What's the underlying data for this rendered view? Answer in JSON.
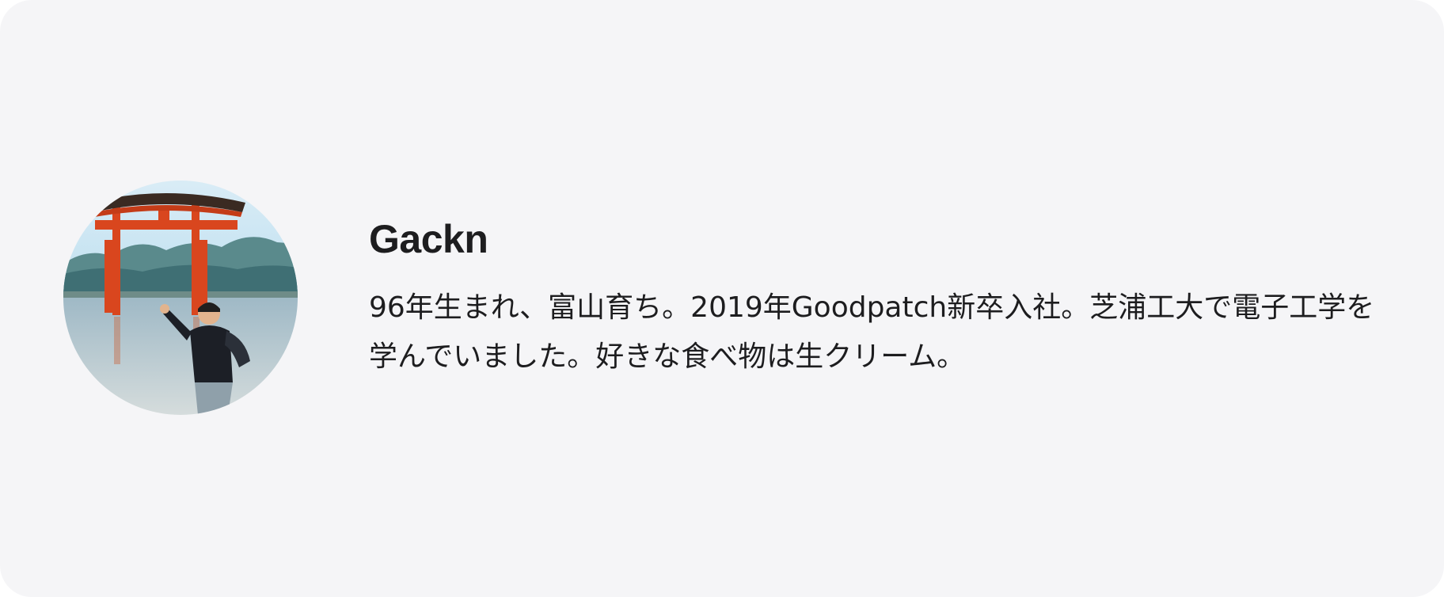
{
  "profile": {
    "name": "Gackn",
    "bio": "96年生まれ、富山育ち。2019年Goodpatch新卒入社。芝浦工大で電子工学を学んでいました。好きな食べ物は生クリーム。",
    "avatar_icon": "profile-photo-torii-gate"
  },
  "colors": {
    "card_background": "#f5f5f7",
    "text": "#1d1d1f",
    "torii_red": "#d9461e"
  }
}
